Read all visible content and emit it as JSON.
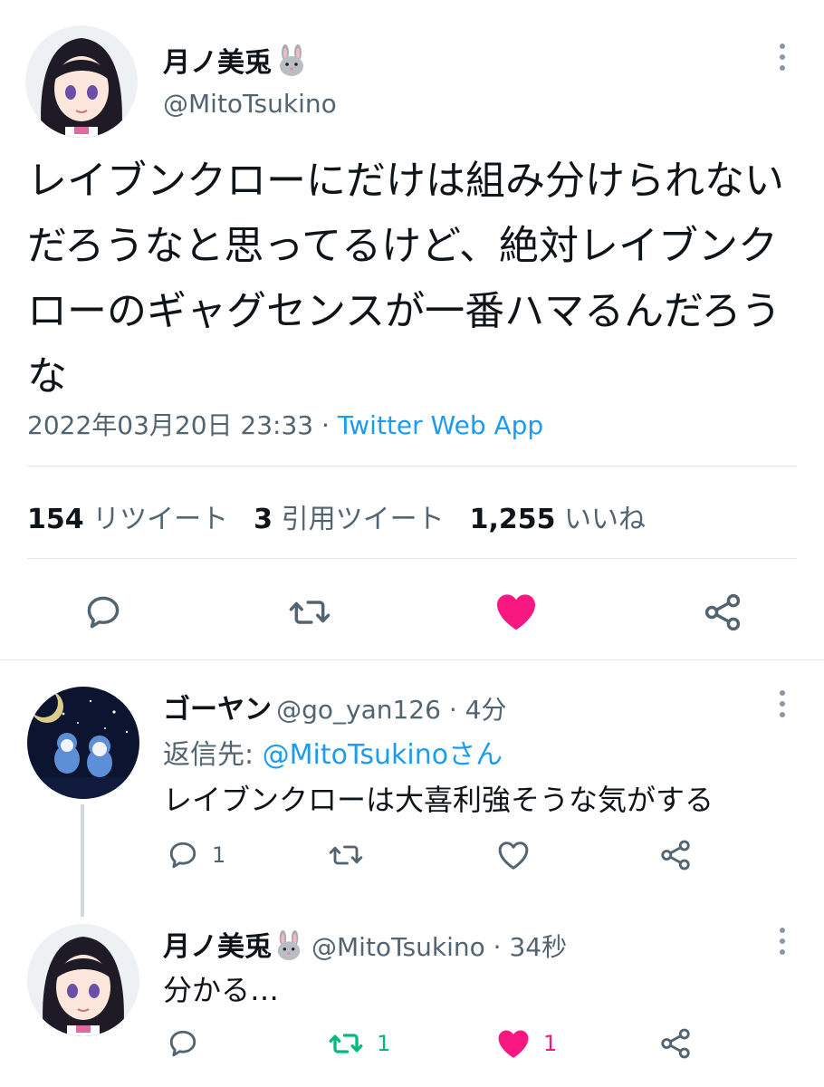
{
  "main_tweet": {
    "display_name": "月ノ美兎",
    "name_icon": "rabbit-face-icon",
    "handle": "@MitoTsukino",
    "text": "レイブンクローにだけは組み分けられないだろうなと思ってるけど、絶対レイブンクローのギャグセンスが一番ハマるんだろうな",
    "timestamp": "2022年03月20日 23:33",
    "separator": " · ",
    "source": "Twitter Web App",
    "stats": {
      "retweets_count": "154",
      "retweets_label": "リツイート",
      "quotes_count": "3",
      "quotes_label": "引用ツイート",
      "likes_count": "1,255",
      "likes_label": "いいね"
    },
    "actions": {
      "reply_icon": "speech-bubble-icon",
      "retweet_icon": "retweet-arrows-icon",
      "like_icon": "heart-icon",
      "share_icon": "share-nodes-icon",
      "liked": true
    }
  },
  "replies": [
    {
      "display_name": "ゴーヤン",
      "handle": "@go_yan126",
      "time": "4分",
      "reply_to_prefix": "返信先: ",
      "reply_to_handle": "@MitoTsukino",
      "reply_to_suffix": "さん",
      "text": "レイブンクローは大喜利強そうな気がする",
      "reply_count": "1",
      "retweet_count": "",
      "like_count": ""
    },
    {
      "display_name": "月ノ美兎",
      "handle": "@MitoTsukino",
      "time": "34秒",
      "text": "分かる…",
      "reply_count": "",
      "retweet_count": "1",
      "like_count": "1",
      "retweeted": true,
      "liked": true
    }
  ],
  "colors": {
    "like_pink": "#f91880",
    "retweet_green": "#00ba7c",
    "link_blue": "#1d9bf0",
    "icon_gray": "#536471"
  }
}
